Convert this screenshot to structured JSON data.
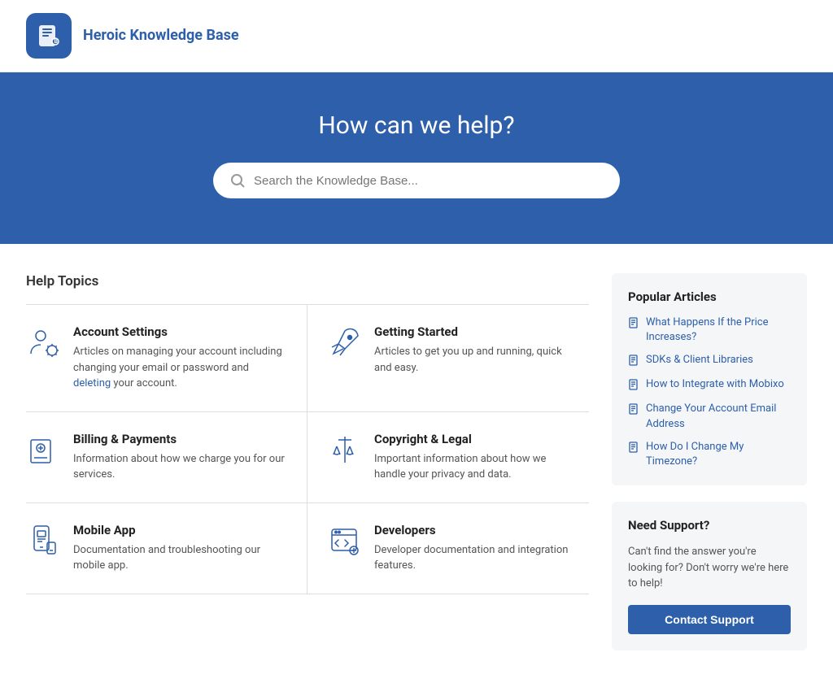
{
  "header": {
    "logo_text": "Heroic\nKnowledge\nBase",
    "logo_alt": "Heroic Knowledge Base"
  },
  "hero": {
    "title": "How can we help?",
    "search_placeholder": "Search the Knowledge Base..."
  },
  "help_topics": {
    "title": "Help Topics",
    "items": [
      {
        "id": "account-settings",
        "title": "Account Settings",
        "description": "Articles on managing your account including changing your email or password and deleting your account.",
        "icon": "user-gear"
      },
      {
        "id": "getting-started",
        "title": "Getting Started",
        "description": "Articles to get you up and running, quick and easy.",
        "icon": "rocket"
      },
      {
        "id": "billing-payments",
        "title": "Billing & Payments",
        "description": "Information about how we charge you for our services.",
        "icon": "billing"
      },
      {
        "id": "copyright-legal",
        "title": "Copyright & Legal",
        "description": "Important information about how we handle your privacy and data.",
        "icon": "legal"
      },
      {
        "id": "mobile-app",
        "title": "Mobile App",
        "description": "Documentation and troubleshooting our mobile app.",
        "icon": "mobile"
      },
      {
        "id": "developers",
        "title": "Developers",
        "description": "Developer documentation and integration features.",
        "icon": "code"
      }
    ]
  },
  "popular_articles": {
    "title": "Popular Articles",
    "items": [
      "What Happens If the Price Increases?",
      "SDKs & Client Libraries",
      "How to Integrate with Mobixo",
      "Change Your Account Email Address",
      "How Do I Change My Timezone?"
    ]
  },
  "need_support": {
    "title": "Need Support?",
    "description": "Can't find the answer you're looking for? Don't worry we're here to help!",
    "button_label": "Contact Support"
  }
}
